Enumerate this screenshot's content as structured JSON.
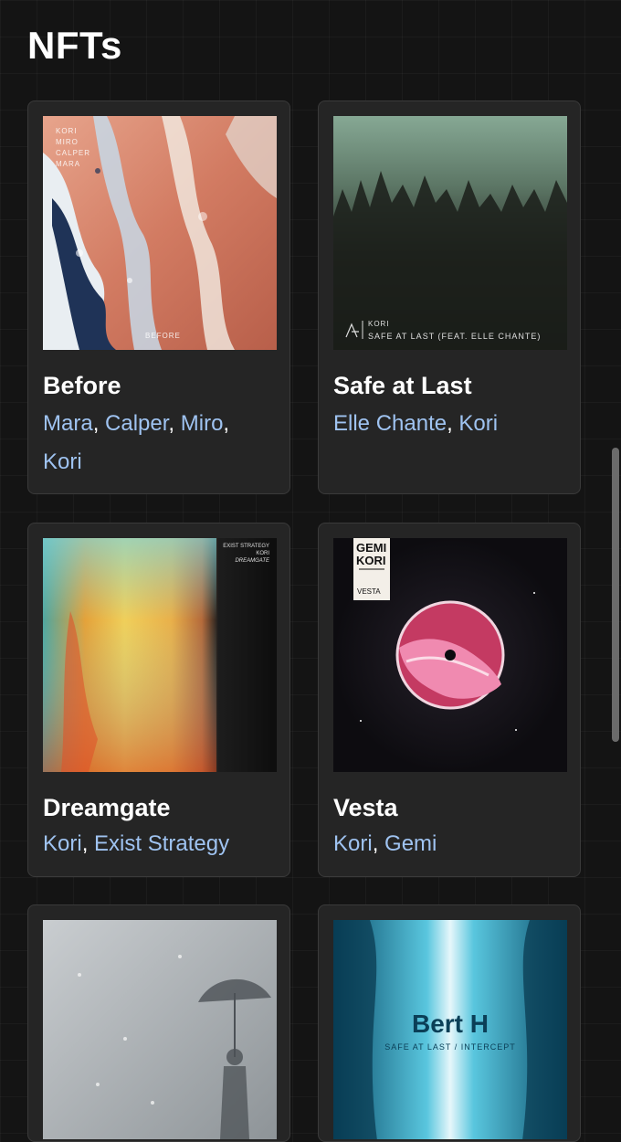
{
  "page": {
    "title": "NFTs"
  },
  "cards": [
    {
      "title": "Before",
      "artists": [
        "Mara",
        "Calper",
        "Miro",
        "Kori"
      ],
      "cover_text": {
        "lines": [
          "KORI",
          "MIRO",
          "CALPER",
          "MARA"
        ],
        "bottom": "BEFORE"
      }
    },
    {
      "title": "Safe at Last",
      "artists": [
        "Elle Chante",
        "Kori"
      ],
      "cover_text": {
        "artist": "KORI",
        "track": "SAFE AT LAST (FEAT. ELLE CHANTE)"
      }
    },
    {
      "title": "Dreamgate",
      "artists": [
        "Kori",
        "Exist Strategy"
      ],
      "cover_text": {
        "lines": [
          "EXIST STRATEGY",
          "KORI",
          "DREAMGATE"
        ]
      }
    },
    {
      "title": "Vesta",
      "artists": [
        "Kori",
        "Gemi"
      ],
      "cover_text": {
        "lines": [
          "GEMI",
          "KORI"
        ],
        "bottom": "VESTA"
      }
    },
    {
      "title": "",
      "artists": [],
      "cover_text": {}
    },
    {
      "title": "",
      "artists": [],
      "cover_text": {
        "artist": "Bert H",
        "track": "SAFE AT LAST / INTERCEPT"
      }
    }
  ],
  "colors": {
    "background": "#141414",
    "card": "#252525",
    "link": "#9fc3f1"
  }
}
